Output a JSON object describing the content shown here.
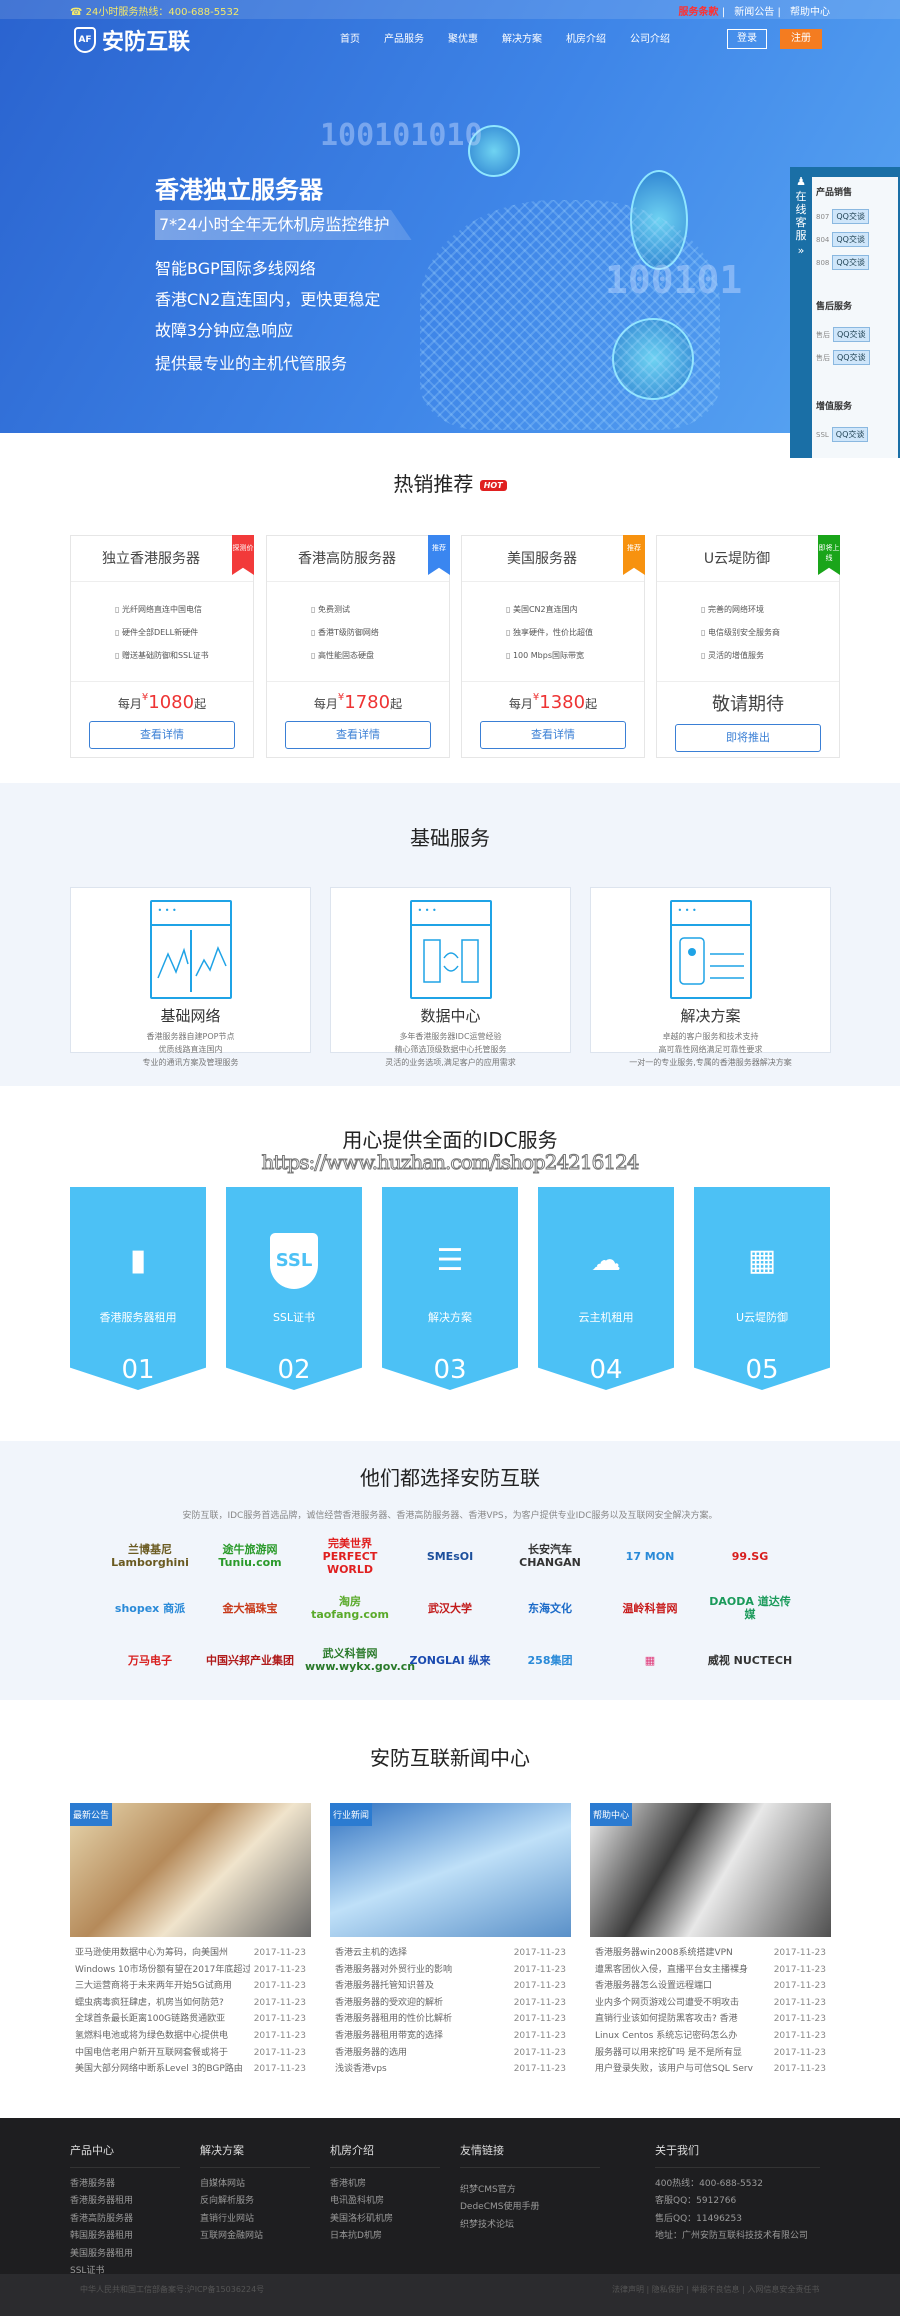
{
  "topbar": {
    "hotline": "☎ 24小时服务热线：400-688-5532",
    "links": [
      "服务条款",
      "新闻公告",
      "帮助中心"
    ],
    "accent": "#e02020"
  },
  "header": {
    "logo": "安防互联",
    "logo_mark": "AF",
    "nav": [
      "首页",
      "产品服务",
      "聚优惠",
      "解决方案",
      "机房介绍",
      "公司介绍"
    ],
    "login": "登录",
    "register": "注册"
  },
  "hero": {
    "title": "香港独立服务器",
    "subtitle": "7*24小时全年无休机房监控维护",
    "lines": [
      "智能BGP国际多线网络",
      "香港CN2直连国内，更快更稳定",
      "故障3分钟应急响应",
      "提供最专业的主机代管服务"
    ],
    "binary1": "100101010",
    "binary2": "100101"
  },
  "kefu": {
    "side": "在线客服",
    "arrow": "»",
    "groups": [
      {
        "title": "产品销售",
        "rows": [
          {
            "name": "807",
            "btn": "QQ交谈"
          },
          {
            "name": "804",
            "btn": "QQ交谈"
          },
          {
            "name": "808",
            "btn": "QQ交谈"
          }
        ]
      },
      {
        "title": "售后服务",
        "rows": [
          {
            "name": "售后",
            "btn": "QQ交谈"
          },
          {
            "name": "售后",
            "btn": "QQ交谈"
          }
        ]
      },
      {
        "title": "增值服务",
        "rows": [
          {
            "name": "SSL",
            "btn": "QQ交谈"
          }
        ]
      }
    ]
  },
  "hot": {
    "title": "热销推荐",
    "badge": "HOT",
    "cards": [
      {
        "name": "独立香港服务器",
        "ribbon": "探测价",
        "ribbon_color": "#f23a3a",
        "features": [
          "光纤网络直连中国电信",
          "硬件全部DELL新硬件",
          "赠送基础防御和SSL证书"
        ],
        "pre": "每月",
        "currency": "¥",
        "price": "1080",
        "post": "起",
        "button": "查看详情"
      },
      {
        "name": "香港高防服务器",
        "ribbon": "推荐",
        "ribbon_color": "#3a86f0",
        "features": [
          "免费测试",
          "香港T级防御网络",
          "高性能固态硬盘"
        ],
        "pre": "每月",
        "currency": "¥",
        "price": "1780",
        "post": "起",
        "button": "查看详情"
      },
      {
        "name": "美国服务器",
        "ribbon": "推荐",
        "ribbon_color": "#f7920f",
        "features": [
          "美国CN2直连国内",
          "独享硬件，性价比超值",
          "100 Mbps国际带宽"
        ],
        "pre": "每月",
        "currency": "¥",
        "price": "1380",
        "post": "起",
        "button": "查看详情"
      },
      {
        "name": "U云堤防御",
        "ribbon": "即将上线",
        "ribbon_color": "#1aa51a",
        "features": [
          "完善的网络环境",
          "电信级别安全服务商",
          "灵活的增值服务"
        ],
        "coming": "敬请期待",
        "button": "即将推出"
      }
    ]
  },
  "basic": {
    "title": "基础服务",
    "cards": [
      {
        "title": "基础网络",
        "desc": [
          "香港服务器自建POP节点",
          "优质线路直连国内",
          "专业的通讯方案及管理服务"
        ]
      },
      {
        "title": "数据中心",
        "desc": [
          "多年香港服务器IDC运营经验",
          "精心筛选顶级数据中心托管服务",
          "灵活的业务选项,满足客户的应用需求"
        ]
      },
      {
        "title": "解决方案",
        "desc": [
          "卓越的客户服务和技术支持",
          "高可靠性网络满足可靠性要求",
          "一对一的专业服务,专属的香港服务器解决方案"
        ]
      }
    ]
  },
  "idc": {
    "title": "用心提供全面的IDC服务",
    "watermark": "https://www.huzhan.com/ishop24216124",
    "items": [
      {
        "label": "香港服务器租用",
        "num": "01",
        "icon": "server-icon"
      },
      {
        "label": "SSL证书",
        "num": "02",
        "icon": "ssl-shield-icon"
      },
      {
        "label": "解决方案",
        "num": "03",
        "icon": "server-shield-icon"
      },
      {
        "label": "云主机租用",
        "num": "04",
        "icon": "cloud-server-icon"
      },
      {
        "label": "U云堤防御",
        "num": "05",
        "icon": "datacenter-icon"
      }
    ]
  },
  "clients": {
    "title": "他们都选择安防互联",
    "subtitle": "安防互联，IDC服务首选品牌，诚信经营香港服务器、香港高防服务器、香港VPS，为客户提供专业IDC服务以及互联网安全解决方案。",
    "logos": [
      {
        "name": "兰博基尼 Lamborghini",
        "color": "#6a5a20"
      },
      {
        "name": "途牛旅游网 Tuniu.com",
        "color": "#2a9a2a"
      },
      {
        "name": "完美世界 PERFECT WORLD",
        "color": "#e02020"
      },
      {
        "name": "SMEsOI",
        "color": "#1c4f9c"
      },
      {
        "name": "长安汽车 CHANGAN",
        "color": "#333"
      },
      {
        "name": "17 MON",
        "color": "#2a8ad8"
      },
      {
        "name": "99.SG",
        "color": "#d81e1e"
      },
      {
        "name": "shopex 商派",
        "color": "#2a8ad8"
      },
      {
        "name": "金大福珠宝",
        "color": "#c83a1a"
      },
      {
        "name": "淘房 taofang.com",
        "color": "#5aaa2a"
      },
      {
        "name": "武汉大学",
        "color": "#c21a1a"
      },
      {
        "name": "东海文化",
        "color": "#1a6ac8"
      },
      {
        "name": "温岭科普网",
        "color": "#c81a1a"
      },
      {
        "name": "DAODA 道达传媒",
        "color": "#1a9a5a"
      },
      {
        "name": "万马电子",
        "color": "#d81e1e"
      },
      {
        "name": "中国兴邦产业集团",
        "color": "#b01a1a"
      },
      {
        "name": "武义科普网 www.wykx.gov.cn",
        "color": "#2a7a2a"
      },
      {
        "name": "ZONGLAI 纵来",
        "color": "#1a4ab0"
      },
      {
        "name": "258集团",
        "color": "#2a8ad8"
      },
      {
        "name": "▦",
        "color": "#e03a7a"
      },
      {
        "name": "威视 NUCTECH",
        "color": "#333"
      }
    ]
  },
  "news": {
    "title": "安防互联新闻中心",
    "columns": [
      {
        "tag": "最新公告",
        "items": [
          [
            "亚马逊使用数据中心为筹码，向美国州",
            "2017-11-23"
          ],
          [
            "Windows 10市场份额有望在2017年底超过",
            "2017-11-23"
          ],
          [
            "三大运营商将于未来两年开始5G试商用",
            "2017-11-23"
          ],
          [
            "蠕虫病毒疯狂肆虐，机房当如何防范?",
            "2017-11-23"
          ],
          [
            "全球首条最长距离100G链路贯通欧亚",
            "2017-11-23"
          ],
          [
            "氢燃料电池或将为绿色数据中心提供电",
            "2017-11-23"
          ],
          [
            "中国电信老用户新开互联网套餐或将于",
            "2017-11-23"
          ],
          [
            "美国大部分网络中断系Level 3的BGP路由",
            "2017-11-23"
          ]
        ]
      },
      {
        "tag": "行业新闻",
        "items": [
          [
            "香港云主机的选择",
            "2017-11-23"
          ],
          [
            "香港服务器对外贸行业的影响",
            "2017-11-23"
          ],
          [
            "香港服务器托管知识普及",
            "2017-11-23"
          ],
          [
            "香港服务器的受欢迎的解析",
            "2017-11-23"
          ],
          [
            "香港服务器租用的性价比解析",
            "2017-11-23"
          ],
          [
            "香港服务器租用带宽的选择",
            "2017-11-23"
          ],
          [
            "香港服务器的选用",
            "2017-11-23"
          ],
          [
            "浅谈香港vps",
            "2017-11-23"
          ]
        ]
      },
      {
        "tag": "帮助中心",
        "items": [
          [
            "香港服务器win2008系统搭建VPN",
            "2017-11-23"
          ],
          [
            "遭黑客团伙入侵，直播平台女主播裸身",
            "2017-11-23"
          ],
          [
            "香港服务器怎么设置远程端口",
            "2017-11-23"
          ],
          [
            "业内多个网页游戏公司遭受不明攻击",
            "2017-11-23"
          ],
          [
            "直销行业该如何提防黑客攻击? 香港",
            "2017-11-23"
          ],
          [
            "Linux Centos 系统忘记密码怎么办",
            "2017-11-23"
          ],
          [
            "服务器可以用来挖矿吗 是不是所有显",
            "2017-11-23"
          ],
          [
            "用户登录失败，该用户与可信SQL Serv",
            "2017-11-23"
          ]
        ]
      }
    ]
  },
  "footer": {
    "columns": [
      {
        "title": "产品中心",
        "items": [
          "香港服务器",
          "香港服务器租用",
          "香港高防服务器",
          "韩国服务器租用",
          "美国服务器租用",
          "SSL证书"
        ]
      },
      {
        "title": "解决方案",
        "items": [
          "自媒体网站",
          "反向解析服务",
          "直销行业网站",
          "互联网金融网站"
        ]
      },
      {
        "title": "机房介绍",
        "items": [
          "香港机房",
          "电讯盈科机房",
          "美国洛杉矶机房",
          "日本抗D机房"
        ]
      },
      {
        "title": "友情链接",
        "items": [
          "织梦CMS官方",
          "DedeCMS使用手册",
          "织梦技术论坛"
        ]
      },
      {
        "title": "关于我们",
        "items": [
          "400热线：400-688-5532",
          "客服QQ：5912766",
          "售后QQ：11496253",
          "地址：广州安防互联科技技术有限公司"
        ]
      }
    ],
    "icp": "中华人民共和国工信部备案号:沪ICP备15036224号",
    "bottom_links": "法律声明 | 隐私保护 | 举报不良信息 | 入网信息安全责任书"
  }
}
